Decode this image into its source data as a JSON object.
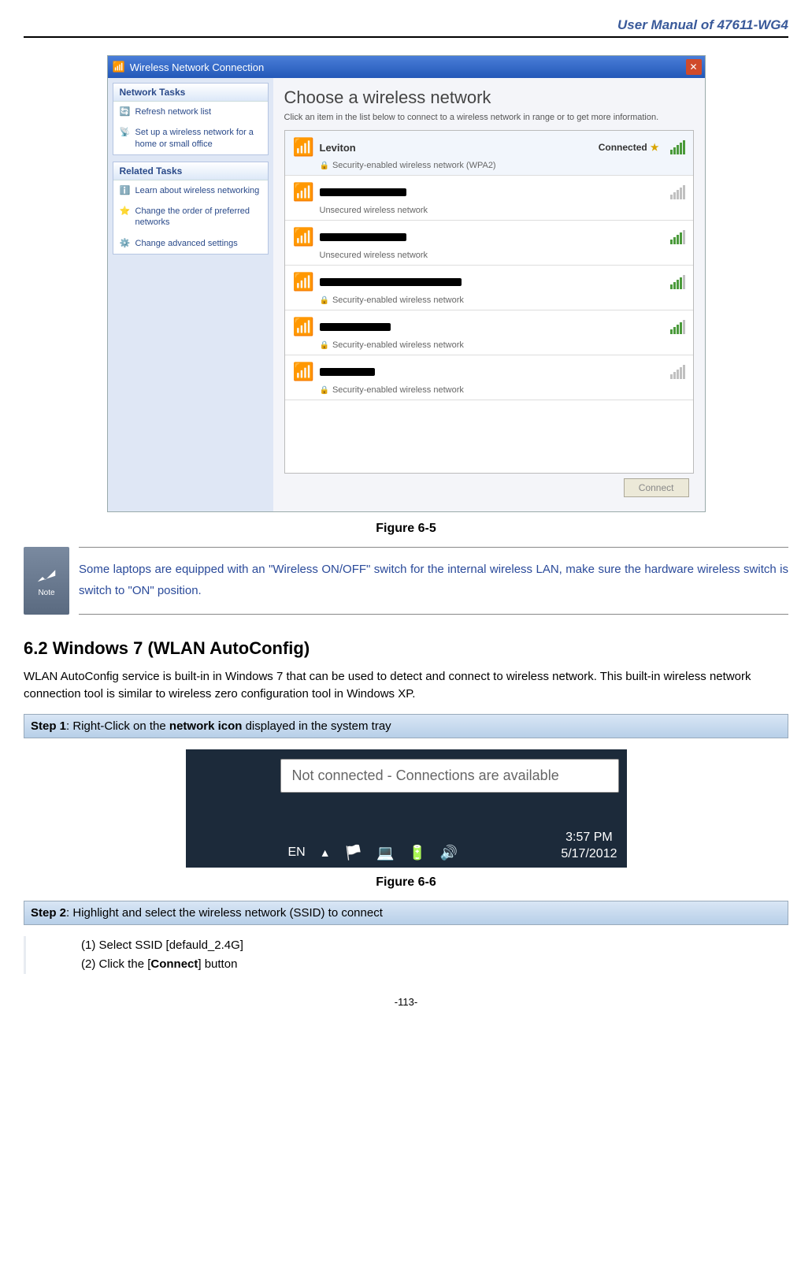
{
  "header": {
    "doc_title": "User Manual of 47611-WG4"
  },
  "figure65": {
    "caption": "Figure 6-5",
    "window_title": "Wireless Network Connection",
    "main_heading": "Choose a wireless network",
    "main_sub": "Click an item in the list below to connect to a wireless network in range or to get more information.",
    "sidebar": {
      "group1_title": "Network Tasks",
      "group1_item1": "Refresh network list",
      "group1_item2": "Set up a wireless network for a home or small office",
      "group2_title": "Related Tasks",
      "group2_item1": "Learn about wireless networking",
      "group2_item2": "Change the order of preferred networks",
      "group2_item3": "Change advanced settings"
    },
    "networks": [
      {
        "name": "Leviton",
        "status": "Connected",
        "desc": "Security-enabled wireless network (WPA2)",
        "secure": true,
        "signal": "full",
        "redacted": false
      },
      {
        "name": "",
        "status": "",
        "desc": "Unsecured wireless network",
        "secure": false,
        "signal": "low",
        "redacted": true
      },
      {
        "name": "",
        "status": "",
        "desc": "Unsecured wireless network",
        "secure": false,
        "signal": "mid",
        "redacted": true
      },
      {
        "name": "",
        "status": "",
        "desc": "Security-enabled wireless network",
        "secure": true,
        "signal": "mid",
        "redacted": true
      },
      {
        "name": "",
        "status": "",
        "desc": "Security-enabled wireless network",
        "secure": true,
        "signal": "mid",
        "redacted": true
      },
      {
        "name": "",
        "status": "",
        "desc": "Security-enabled wireless network",
        "secure": true,
        "signal": "low",
        "redacted": true
      }
    ],
    "connect_btn": "Connect"
  },
  "note": {
    "label": "Note",
    "text": "Some laptops are equipped with an \"Wireless ON/OFF\" switch for the internal wireless LAN, make sure the hardware wireless switch is switch to \"ON\" position."
  },
  "section62": {
    "heading": "6.2  Windows 7 (WLAN AutoConfig)",
    "paragraph": "WLAN AutoConfig service is built-in in Windows 7 that can be used to detect and connect to wireless network. This built-in wireless network connection tool is similar to wireless zero configuration tool in Windows XP."
  },
  "step1": {
    "prefix": "Step 1",
    "text_before": ": Right-Click on the ",
    "bold": "network icon",
    "text_after": " displayed in the system tray"
  },
  "figure66": {
    "caption": "Figure 6-6",
    "tooltip": "Not connected - Connections are available",
    "lang": "EN",
    "time": "3:57 PM",
    "date": "5/17/2012"
  },
  "step2": {
    "prefix": "Step 2",
    "text": ": Highlight and select the wireless network (SSID) to connect",
    "sub1_num": "(1)",
    "sub1_text": "Select SSID [defauld_2.4G]",
    "sub2_num": "(2)",
    "sub2_before": "Click the [",
    "sub2_bold": "Connect",
    "sub2_after": "] button"
  },
  "page_number": "-113-"
}
